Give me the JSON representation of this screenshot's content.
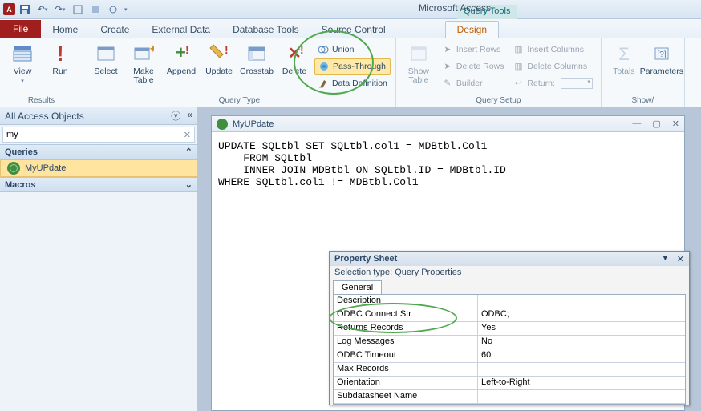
{
  "app_title": "Microsoft Access",
  "context_tab": "Query Tools",
  "tabs": {
    "file": "File",
    "home": "Home",
    "create": "Create",
    "external": "External Data",
    "dbtools": "Database Tools",
    "source": "Source Control",
    "design": "Design"
  },
  "ribbon": {
    "results": {
      "view": "View",
      "run": "Run",
      "label": "Results"
    },
    "qtype": {
      "select": "Select",
      "make": "Make\nTable",
      "append": "Append",
      "update": "Update",
      "crosstab": "Crosstab",
      "delete": "Delete",
      "union": "Union",
      "passthrough": "Pass-Through",
      "datadef": "Data Definition",
      "label": "Query Type"
    },
    "qsetup": {
      "showtable": "Show\nTable",
      "insrows": "Insert Rows",
      "delrows": "Delete Rows",
      "builder": "Builder",
      "inscols": "Insert Columns",
      "delcols": "Delete Columns",
      "return": "Return:",
      "label": "Query Setup"
    },
    "showhide": {
      "totals": "Totals",
      "params": "Parameters",
      "label": "Show/"
    }
  },
  "nav": {
    "header": "All Access Objects",
    "search_value": "my",
    "cat_queries": "Queries",
    "item1": "MyUPdate",
    "cat_macros": "Macros"
  },
  "doc": {
    "title": "MyUPdate",
    "sql": "UPDATE SQLtbl SET SQLtbl.col1 = MDBtbl.Col1\n    FROM SQLtbl\n    INNER JOIN MDBtbl ON SQLtbl.ID = MDBtbl.ID\nWHERE SQLtbl.col1 != MDBtbl.Col1"
  },
  "propsheet": {
    "title": "Property Sheet",
    "subtitle": "Selection type:  Query Properties",
    "tab": "General",
    "rows": [
      {
        "k": "Description",
        "v": ""
      },
      {
        "k": "ODBC Connect Str",
        "v": "ODBC;"
      },
      {
        "k": "Returns Records",
        "v": "Yes"
      },
      {
        "k": "Log Messages",
        "v": "No"
      },
      {
        "k": "ODBC Timeout",
        "v": "60"
      },
      {
        "k": "Max Records",
        "v": ""
      },
      {
        "k": "Orientation",
        "v": "Left-to-Right"
      },
      {
        "k": "Subdatasheet Name",
        "v": ""
      }
    ]
  }
}
